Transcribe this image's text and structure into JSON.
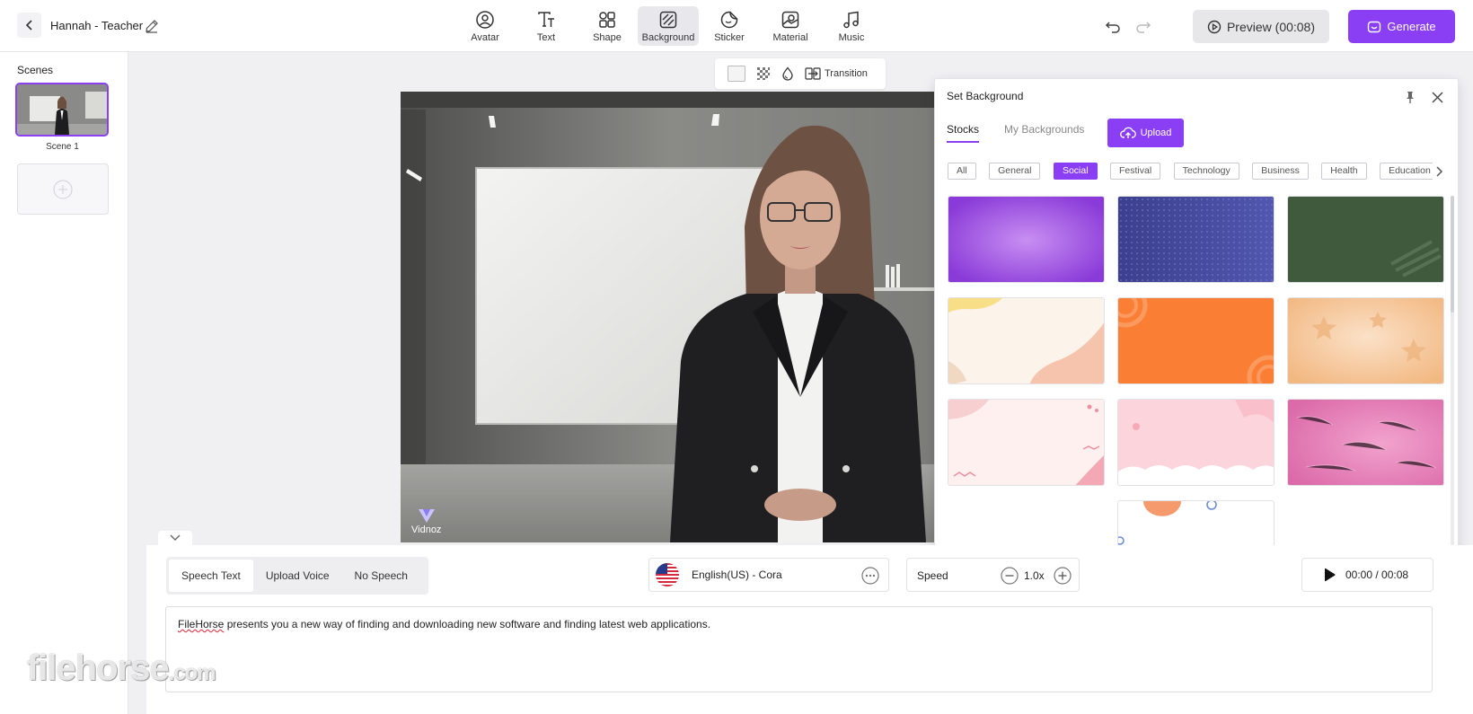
{
  "header": {
    "project_title": "Hannah - Teacher",
    "tools": [
      {
        "label": "Avatar",
        "icon": "avatar-icon"
      },
      {
        "label": "Text",
        "icon": "text-icon"
      },
      {
        "label": "Shape",
        "icon": "shape-icon"
      },
      {
        "label": "Background",
        "icon": "background-icon",
        "active": true
      },
      {
        "label": "Sticker",
        "icon": "sticker-icon"
      },
      {
        "label": "Material",
        "icon": "material-icon"
      },
      {
        "label": "Music",
        "icon": "music-icon"
      }
    ],
    "preview_label": "Preview (00:08)",
    "generate_label": "Generate"
  },
  "scenes": {
    "heading": "Scenes",
    "items": [
      {
        "name": "Scene 1",
        "selected": true
      }
    ]
  },
  "canvas_toolbar": {
    "transition_label": "Transition"
  },
  "stage": {
    "brand_label": "Vidnoz"
  },
  "background_panel": {
    "title": "Set Background",
    "tabs": [
      {
        "label": "Stocks",
        "active": true
      },
      {
        "label": "My Backgrounds",
        "active": false
      }
    ],
    "upload_label": "Upload",
    "categories": [
      "All",
      "General",
      "Social",
      "Festival",
      "Technology",
      "Business",
      "Health",
      "Education"
    ],
    "active_category": "Social",
    "thumbnails": [
      {
        "name": "purple-gradient"
      },
      {
        "name": "blue-dots"
      },
      {
        "name": "green-chalk"
      },
      {
        "name": "cream-peach-waves"
      },
      {
        "name": "orange-circles"
      },
      {
        "name": "peach-stars"
      },
      {
        "name": "pink-dotted"
      },
      {
        "name": "pink-clouds"
      },
      {
        "name": "pink-fur"
      },
      {
        "name": "white-orange-circle"
      }
    ]
  },
  "script": {
    "speech_tabs": [
      {
        "label": "Speech Text",
        "active": true
      },
      {
        "label": "Upload Voice",
        "active": false
      },
      {
        "label": "No Speech",
        "active": false
      }
    ],
    "voice_label": "English(US) - Cora",
    "speed_label": "Speed",
    "speed_value": "1.0x",
    "time_label": "00:00 / 00:08",
    "text_spell": "FileHorse",
    "text_rest": " presents you a new way of finding and downloading new software and finding latest web applications."
  },
  "watermark": {
    "main": "filehorse",
    "suffix": ".com"
  },
  "colors": {
    "accent": "#8a3ff5"
  }
}
